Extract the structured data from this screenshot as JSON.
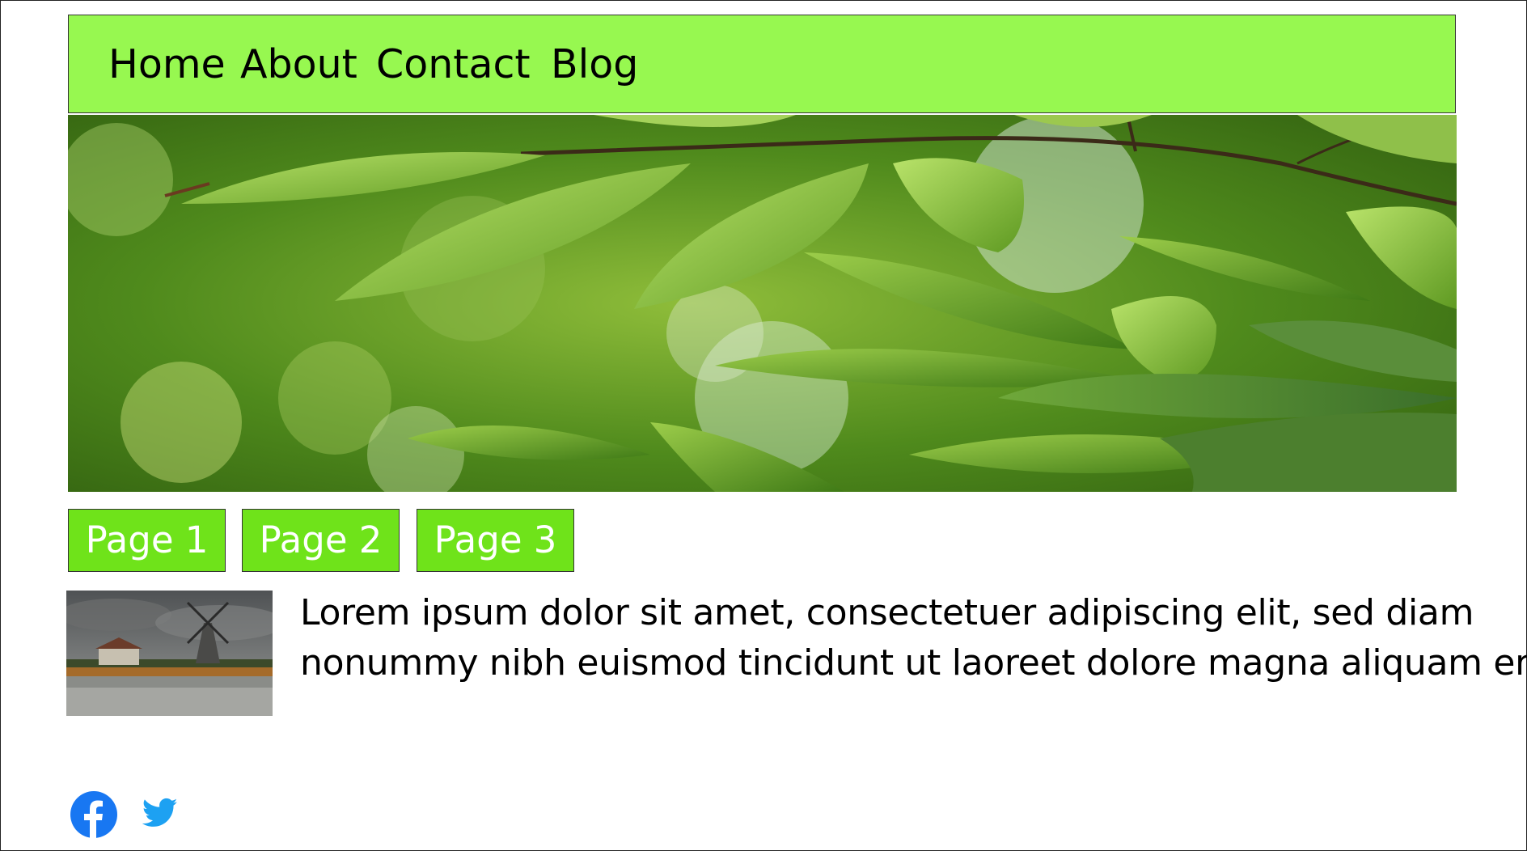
{
  "nav": {
    "items": [
      {
        "label": "Home"
      },
      {
        "label": "About"
      },
      {
        "label": "Contact"
      },
      {
        "label": "Blog"
      }
    ]
  },
  "colors": {
    "nav_bg": "#97f850",
    "tab_bg": "#6fe31a",
    "tab_text": "#ffffff",
    "facebook": "#1877f2",
    "twitter": "#1da1f2"
  },
  "hero": {
    "icon": "green-leaves-photo"
  },
  "tabs": [
    {
      "label": "Page 1"
    },
    {
      "label": "Page 2"
    },
    {
      "label": "Page 3"
    }
  ],
  "article": {
    "thumbnail_icon": "windmill-landscape-photo",
    "line1": "Lorem ipsum dolor sit amet, consectetuer adipiscing elit, sed diam",
    "line2": "nonummy nibh euismod tincidunt ut laoreet dolore magna aliquam erat"
  },
  "social": [
    {
      "icon": "facebook-icon"
    },
    {
      "icon": "twitter-icon"
    }
  ]
}
